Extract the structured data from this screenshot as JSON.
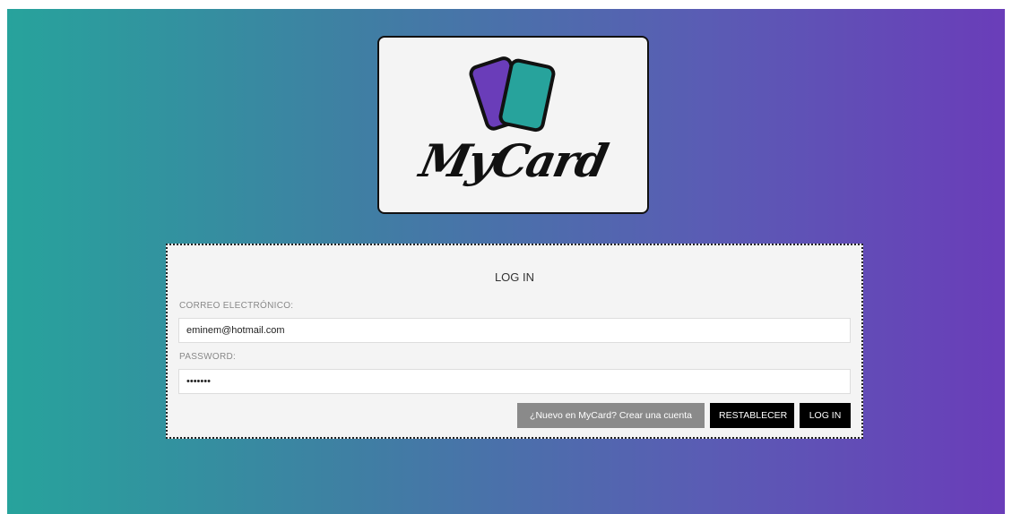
{
  "logo": {
    "wordmark": "MyCard",
    "card_back_color": "#6a3db9",
    "card_front_color": "#27a39c"
  },
  "login": {
    "title": "LOG IN",
    "email_label": "CORREO ELECTRÓNICO:",
    "email_value": "eminem@hotmail.com",
    "password_label": "PASSWORD:",
    "password_value": "•••••••",
    "new_account_label": "¿Nuevo en MyCard? Crear una cuenta",
    "reset_label": "RESTABLECER",
    "login_label": "LOG IN"
  },
  "colors": {
    "gradient_start": "#27a39c",
    "gradient_end": "#6a3db9",
    "panel_bg": "#f4f4f4",
    "button_dark": "#000000",
    "button_grey": "#8a8a8a"
  }
}
